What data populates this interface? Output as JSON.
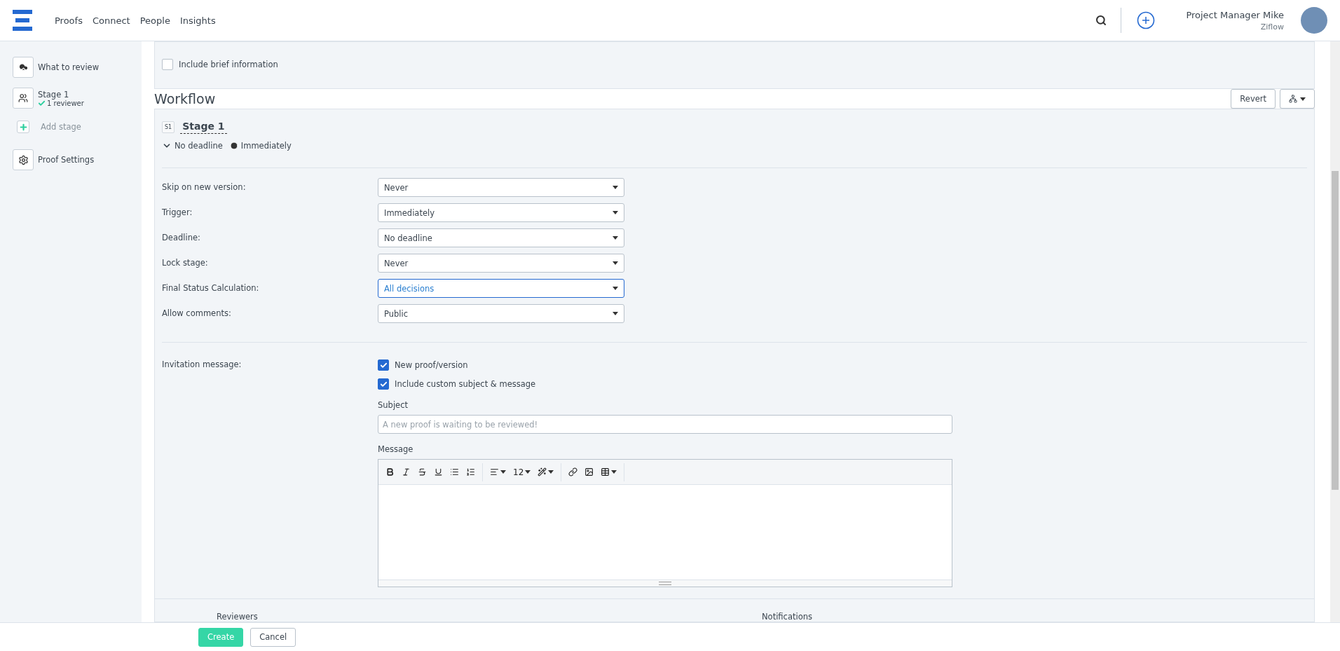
{
  "nav": {
    "links": [
      "Proofs",
      "Connect",
      "People",
      "Insights"
    ],
    "user": {
      "name": "Project Manager Mike",
      "org": "Ziflow"
    }
  },
  "sidebar": {
    "items": [
      {
        "kind": "upload",
        "title": "What to review"
      },
      {
        "kind": "stage",
        "title": "Stage 1",
        "subtitle": "1 reviewer"
      },
      {
        "kind": "add",
        "title": "Add stage"
      },
      {
        "kind": "settings",
        "title": "Proof Settings"
      }
    ]
  },
  "brief": {
    "label": "Include brief information",
    "checked": false
  },
  "workflow": {
    "title": "Workflow",
    "revert": "Revert"
  },
  "stage": {
    "badge": "S1",
    "title": "Stage 1",
    "deadline": "No deadline",
    "trigger": "Immediately",
    "settings": [
      {
        "label": "Skip on new version:",
        "value": "Never",
        "focused": false
      },
      {
        "label": "Trigger:",
        "value": "Immediately",
        "focused": false
      },
      {
        "label": "Deadline:",
        "value": "No deadline",
        "focused": false
      },
      {
        "label": "Lock stage:",
        "value": "Never",
        "focused": false
      },
      {
        "label": "Final Status Calculation:",
        "value": "All decisions",
        "focused": true
      },
      {
        "label": "Allow comments:",
        "value": "Public",
        "focused": false
      }
    ],
    "invitation": {
      "label": "Invitation message:",
      "options": [
        {
          "label": "New proof/version",
          "checked": true
        },
        {
          "label": "Include custom subject & message",
          "checked": true
        }
      ],
      "subject_label": "Subject",
      "subject_placeholder": "A new proof is waiting to be reviewed!",
      "message_label": "Message",
      "font_size": "12"
    }
  },
  "columns": [
    "Reviewers",
    "Notifications"
  ],
  "footer": {
    "buttons": [
      {
        "label": "Create",
        "kind": "primary"
      },
      {
        "label": "Cancel",
        "kind": "secondary"
      }
    ]
  }
}
